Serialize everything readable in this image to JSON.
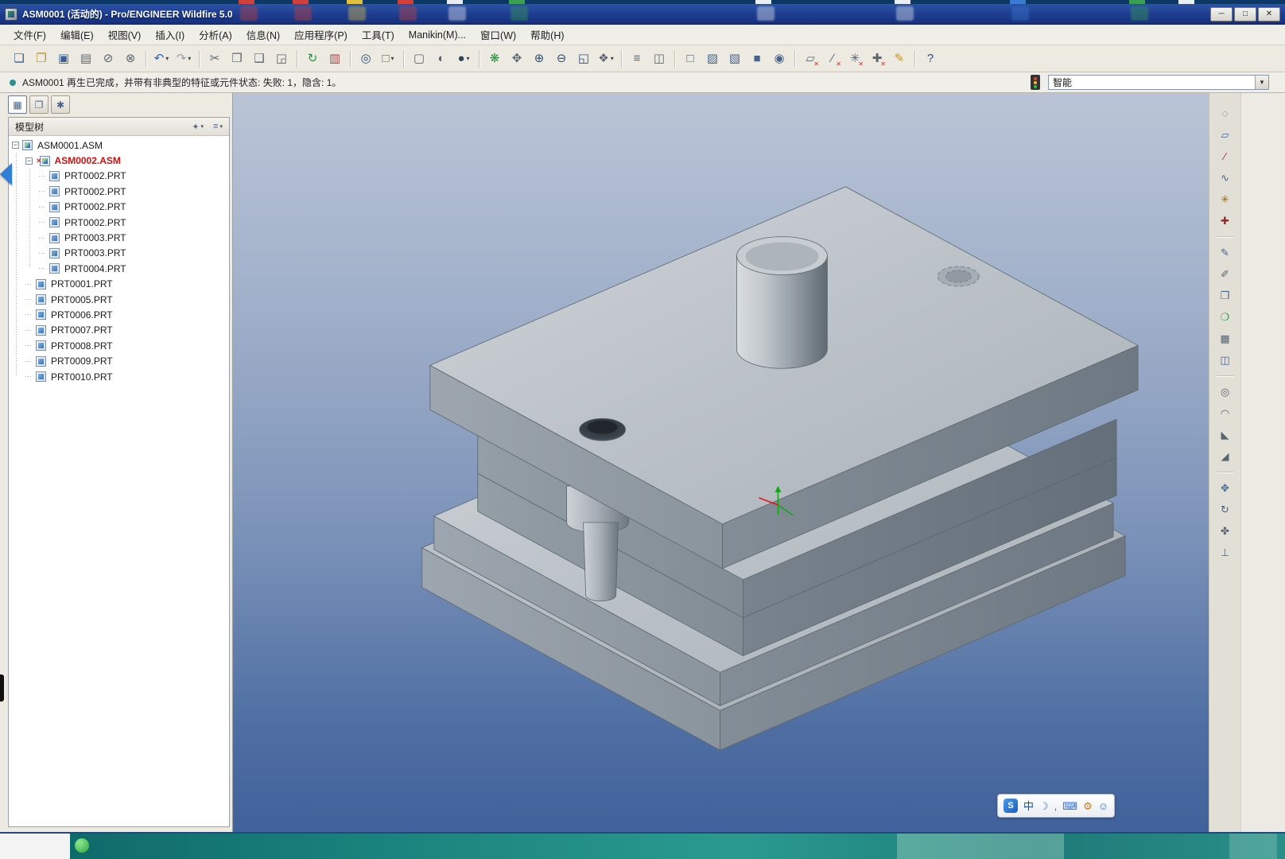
{
  "window": {
    "title": "ASM0001 (活动的) - Pro/ENGINEER Wildfire 5.0",
    "minimize_label": "─",
    "maximize_label": "□",
    "close_label": "✕"
  },
  "menu": {
    "items": [
      {
        "label": "文件(F)"
      },
      {
        "label": "编辑(E)"
      },
      {
        "label": "视图(V)"
      },
      {
        "label": "插入(I)"
      },
      {
        "label": "分析(A)"
      },
      {
        "label": "信息(N)"
      },
      {
        "label": "应用程序(P)"
      },
      {
        "label": "工具(T)"
      },
      {
        "label": "Manikin(M)..."
      },
      {
        "label": "窗口(W)"
      },
      {
        "label": "帮助(H)"
      }
    ]
  },
  "toolbar": {
    "buttons": [
      {
        "name": "new-file-button",
        "glyph": "❏",
        "color": "#3c5e95"
      },
      {
        "name": "open-file-button",
        "glyph": "❐",
        "color": "#c0922e"
      },
      {
        "name": "save-file-button",
        "glyph": "▣",
        "color": "#3c5e95"
      },
      {
        "name": "print-button",
        "glyph": "▤",
        "color": "#5a6570"
      },
      {
        "name": "erase-not-displayed-button",
        "glyph": "⊘",
        "color": "#5a6570"
      },
      {
        "name": "delete-old-versions-button",
        "glyph": "⊗",
        "color": "#5a6570"
      },
      {
        "sep": true
      },
      {
        "name": "undo-button",
        "glyph": "↶",
        "color": "#2e66c0",
        "arrow": "▾"
      },
      {
        "name": "redo-button",
        "glyph": "↷",
        "color": "#9aa3ad",
        "arrow": "▾"
      },
      {
        "sep": true
      },
      {
        "name": "cut-button",
        "glyph": "✂",
        "color": "#5a6570"
      },
      {
        "name": "copy-button",
        "glyph": "❒",
        "color": "#5a6570"
      },
      {
        "name": "paste-button",
        "glyph": "❑",
        "color": "#5a6570"
      },
      {
        "name": "paste-special-button",
        "glyph": "◲",
        "color": "#5a6570"
      },
      {
        "sep": true
      },
      {
        "name": "regenerate-button",
        "glyph": "↻",
        "color": "#2f8f3f"
      },
      {
        "name": "failed-feature-manager-button",
        "glyph": "▥",
        "color": "#a04848"
      },
      {
        "sep": true
      },
      {
        "name": "find-button",
        "glyph": "◎",
        "color": "#2f4f7f"
      },
      {
        "name": "select-box-button",
        "glyph": "□",
        "color": "#5a6570",
        "arrow": "▾"
      },
      {
        "sep": true
      },
      {
        "name": "repaint-button",
        "glyph": "▢",
        "color": "#5a6570"
      },
      {
        "name": "shade-button",
        "glyph": "◐",
        "color": "#5a6570"
      },
      {
        "name": "display-style-button",
        "glyph": "●",
        "color": "#32445e",
        "arrow": "▾"
      },
      {
        "sep": true
      },
      {
        "name": "spin-center-button",
        "glyph": "❋",
        "color": "#2f8f3f"
      },
      {
        "name": "orient-mode-button",
        "glyph": "✥",
        "color": "#5a6570"
      },
      {
        "name": "zoom-in-button",
        "glyph": "⊕",
        "color": "#2f4f7f"
      },
      {
        "name": "zoom-out-button",
        "glyph": "⊖",
        "color": "#2f4f7f"
      },
      {
        "name": "refit-button",
        "glyph": "◱",
        "color": "#2f4f7f"
      },
      {
        "name": "saved-views-button",
        "glyph": "❖",
        "color": "#5a6570",
        "arrow": "▾"
      },
      {
        "sep": true
      },
      {
        "name": "layers-button",
        "glyph": "≡",
        "color": "#5a6570"
      },
      {
        "name": "view-manager-button",
        "glyph": "◫",
        "color": "#5a6570"
      },
      {
        "sep": true
      },
      {
        "name": "display-wireframe-button",
        "glyph": "□",
        "color": "#46648c"
      },
      {
        "name": "display-hidden-line-button",
        "glyph": "▨",
        "color": "#46648c"
      },
      {
        "name": "display-no-hidden-button",
        "glyph": "▧",
        "color": "#46648c"
      },
      {
        "name": "display-shaded-button",
        "glyph": "■",
        "color": "#46648c"
      },
      {
        "name": "datum-display-button",
        "glyph": "◉",
        "color": "#46648c"
      },
      {
        "sep": true
      },
      {
        "name": "plane-display-toggle",
        "glyph": "▱",
        "color": "#5a6570",
        "badge": "✕"
      },
      {
        "name": "axis-display-toggle",
        "glyph": "∕",
        "color": "#5a6570",
        "badge": "✕"
      },
      {
        "name": "point-display-toggle",
        "glyph": "✳",
        "color": "#5a6570",
        "badge": "✕"
      },
      {
        "name": "csys-display-toggle",
        "glyph": "✚",
        "color": "#5a6570",
        "badge": "✕"
      },
      {
        "name": "annotation-display-toggle",
        "glyph": "✎",
        "color": "#c0922e"
      },
      {
        "sep": true
      },
      {
        "name": "context-help-button",
        "glyph": "?",
        "color": "#2f4f7f"
      }
    ]
  },
  "message_bar": {
    "text": "ASM0001 再生已完成，并带有非典型的特征或元件状态: 失败: 1，隐含: 1。"
  },
  "selection_filter": {
    "value": "智能",
    "dropdown_glyph": "▼"
  },
  "left_panel": {
    "tabs": [
      {
        "name": "model-tree-tab",
        "glyph": "▦",
        "class": "active"
      },
      {
        "name": "folder-browser-tab",
        "glyph": "❐"
      },
      {
        "name": "favorites-tab",
        "glyph": "✱"
      }
    ],
    "header": {
      "title": "模型树",
      "show_button_glyph": "✦",
      "settings_button_glyph": "≡",
      "dropdown_glyph": "▾"
    },
    "tree": [
      {
        "label": "ASM0001.ASM",
        "level": 0,
        "class": "asm",
        "expand": "−"
      },
      {
        "label": "ASM0002.ASM",
        "level": 1,
        "class": "asm failed",
        "expand": "−",
        "badge": "✕"
      },
      {
        "label": "PRT0002.PRT",
        "level": 2,
        "class": "prt",
        "stub": true
      },
      {
        "label": "PRT0002.PRT",
        "level": 2,
        "class": "prt",
        "stub": true
      },
      {
        "label": "PRT0002.PRT",
        "level": 2,
        "class": "prt",
        "stub": true
      },
      {
        "label": "PRT0002.PRT",
        "level": 2,
        "class": "prt",
        "stub": true
      },
      {
        "label": "PRT0003.PRT",
        "level": 2,
        "class": "prt",
        "stub": true
      },
      {
        "label": "PRT0003.PRT",
        "level": 2,
        "class": "prt",
        "stub": true
      },
      {
        "label": "PRT0004.PRT",
        "level": 2,
        "class": "prt",
        "stub": true
      },
      {
        "label": "PRT0001.PRT",
        "level": 1,
        "class": "prt",
        "stub": true
      },
      {
        "label": "PRT0005.PRT",
        "level": 1,
        "class": "prt",
        "stub": true
      },
      {
        "label": "PRT0006.PRT",
        "level": 1,
        "class": "prt",
        "stub": true
      },
      {
        "label": "PRT0007.PRT",
        "level": 1,
        "class": "prt",
        "stub": true
      },
      {
        "label": "PRT0008.PRT",
        "level": 1,
        "class": "prt",
        "stub": true
      },
      {
        "label": "PRT0009.PRT",
        "level": 1,
        "class": "prt",
        "stub": true
      },
      {
        "label": "PRT0010.PRT",
        "level": 1,
        "class": "prt",
        "stub": true
      }
    ]
  },
  "right_toolbar": {
    "buttons": [
      {
        "name": "select-special-button",
        "glyph": "◌",
        "color": "#46648c"
      },
      {
        "name": "datum-plane-button",
        "glyph": "▱",
        "color": "#46648c"
      },
      {
        "name": "datum-axis-button",
        "glyph": "∕",
        "color": "#8a3030"
      },
      {
        "name": "datum-curve-button",
        "glyph": "∿",
        "color": "#46648c"
      },
      {
        "name": "datum-point-button",
        "glyph": "✳",
        "color": "#8a6a2a"
      },
      {
        "name": "datum-csys-button",
        "glyph": "✚",
        "color": "#8a3030"
      },
      {
        "sep": true
      },
      {
        "name": "sketch-tool-button",
        "glyph": "✎",
        "color": "#46648c"
      },
      {
        "name": "edit-definition-button",
        "glyph": "✐",
        "color": "#5a6570"
      },
      {
        "name": "assemble-component-button",
        "glyph": "❒",
        "color": "#46648c"
      },
      {
        "name": "create-component-button",
        "glyph": "❍",
        "color": "#2f8f3f"
      },
      {
        "name": "pattern-tool-button",
        "glyph": "▦",
        "color": "#46648c"
      },
      {
        "name": "mirror-tool-button",
        "glyph": "◫",
        "color": "#46648c"
      },
      {
        "sep": true
      },
      {
        "name": "hole-tool-button",
        "glyph": "◎",
        "color": "#5a6570"
      },
      {
        "name": "round-tool-button",
        "glyph": "◠",
        "color": "#5a6570"
      },
      {
        "name": "chamfer-tool-button",
        "glyph": "◣",
        "color": "#5a6570"
      },
      {
        "name": "rib-tool-button",
        "glyph": "◢",
        "color": "#5a6570"
      },
      {
        "sep": true
      },
      {
        "name": "move-component-button",
        "glyph": "✥",
        "color": "#46648c"
      },
      {
        "name": "rotate-component-button",
        "glyph": "↻",
        "color": "#46648c"
      },
      {
        "name": "drag-component-button",
        "glyph": "✤",
        "color": "#5a6570"
      },
      {
        "name": "constraint-tool-button",
        "glyph": "⊥",
        "color": "#5a6570"
      }
    ]
  },
  "ime_bar": {
    "logo": "S",
    "items": [
      {
        "name": "ime-lang-indicator",
        "glyph": "中",
        "color": "#1a4f9e"
      },
      {
        "name": "ime-moon-icon",
        "glyph": "☽",
        "color": "#2a6fd0"
      },
      {
        "name": "ime-punctuation-icon",
        "glyph": ",",
        "color": "#2a6fd0"
      },
      {
        "name": "ime-keyboard-icon",
        "glyph": "⌨",
        "color": "#2a6fd0"
      },
      {
        "name": "ime-wrench-icon",
        "glyph": "⚙",
        "color": "#c07828"
      },
      {
        "name": "ime-smiley-icon",
        "glyph": "☺",
        "color": "#2a6fd0"
      }
    ]
  },
  "colors": {
    "titlebar": "#1d3c8e",
    "viewport_top": "#b9c4d6",
    "viewport_bottom": "#40619b",
    "model_top_face": "#ced3d7",
    "model_left_face": "#9da6ae",
    "model_right_face": "#6d7882",
    "failed_text": "#cc1111",
    "chrome": "#edeae2",
    "taskbar_teal": "#1a827c"
  }
}
